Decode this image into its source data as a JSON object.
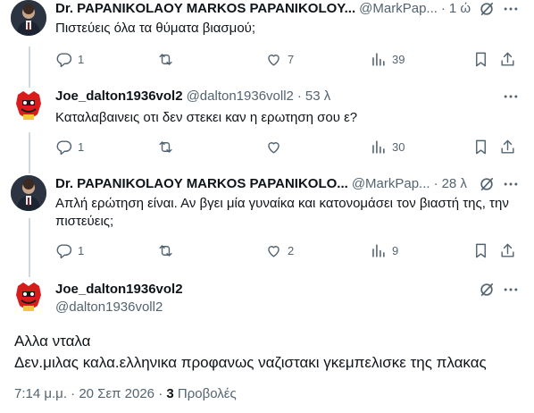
{
  "replies": [
    {
      "name": "Dr. PAPANIKOLAOY MARKOS PAPANIKOLOY...",
      "handle": "@MarkPap...",
      "sep": "·",
      "time": "1 ώ",
      "text": "Πιστεύεις όλα τα θύματα βιασμού;",
      "replies": "1",
      "reposts": "",
      "likes": "7",
      "views": "39"
    },
    {
      "name": "Joe_dalton1936vol2",
      "handle": "@dalton1936voll2",
      "sep": "·",
      "time": "53 λ",
      "text": "Καταλαβαινεις οτι δεν στεκει καν η ερωτηση σου ε?",
      "replies": "1",
      "reposts": "",
      "likes": "",
      "views": "30"
    },
    {
      "name": "Dr. PAPANIKOLAOY MARKOS PAPANIKOLO...",
      "handle": "@MarkPap...",
      "sep": "·",
      "time": "28 λ",
      "text": "Απλή ερώτηση είναι. Αν βγει μία γυναίκα και κατονομάσει τον βιαστή της, την πιστεύεις;",
      "replies": "1",
      "reposts": "",
      "likes": "2",
      "views": "9"
    }
  ],
  "main": {
    "name": "Joe_dalton1936vol2",
    "handle": "@dalton1936voll2",
    "line1": "Αλλα νταλα",
    "line2": "Δεν.μιλας καλα.ελληνικα προφανως ναζιστακι γκεμπελισκε της πλακας",
    "time": "7:14 μ.μ.",
    "sep": "·",
    "date": "20 Σεπ 2026",
    "sep2": "·",
    "views_count": "3",
    "views_label": "Προβολές"
  },
  "colors": {
    "text": "#0f1419",
    "secondary": "#536471",
    "thread": "#cfd9de",
    "joe_avatar": "#d81c1c"
  },
  "icons": [
    "grok-icon",
    "more-icon",
    "reply-icon",
    "repost-icon",
    "like-icon",
    "views-icon",
    "bookmark-icon",
    "share-icon"
  ]
}
